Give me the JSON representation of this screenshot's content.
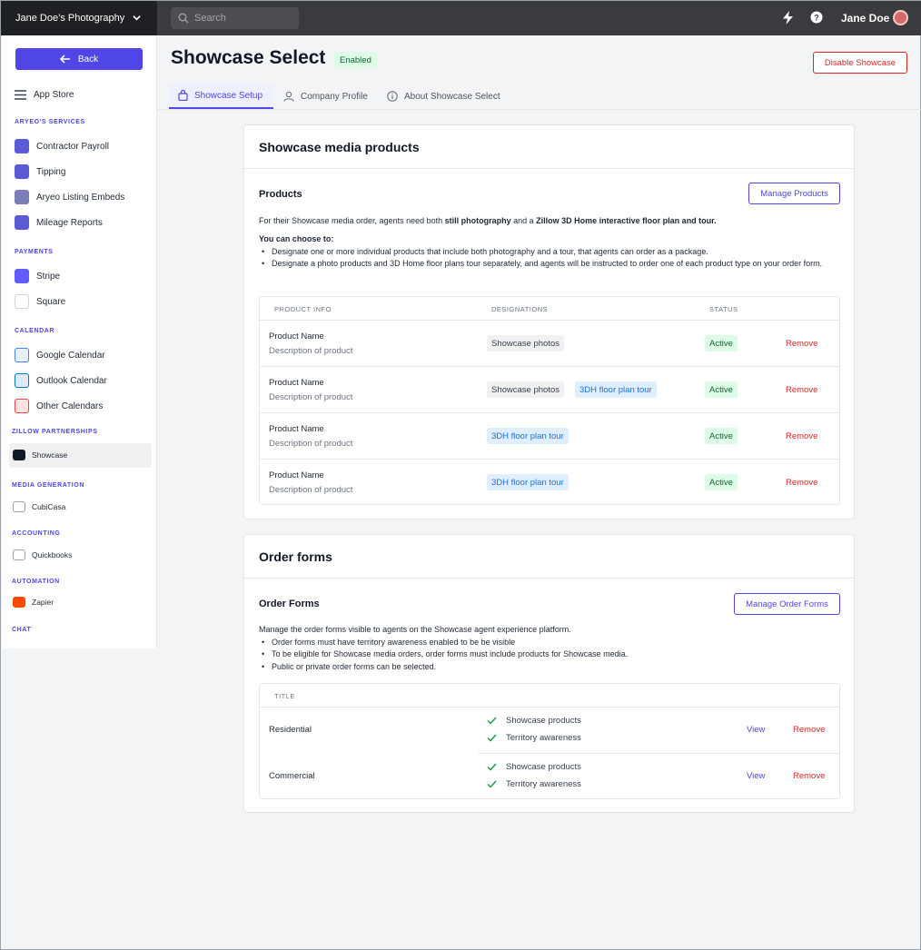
{
  "topbar": {
    "workspace": "Jane Doe’s Photography",
    "search_placeholder": "Search",
    "user_name": "Jane Doe"
  },
  "sidebar": {
    "back_label": "Back",
    "app_store_label": "App Store",
    "sections": {
      "services": "ARYEO'S SERVICES",
      "payments": "PAYMENTS",
      "calendar": "CALENDAR",
      "zillow": "ZILLOW PARTNERSHIPS",
      "media": "MEDIA GENERATION",
      "accounting": "ACCOUNTING",
      "automation": "AUTOMATION",
      "chat": "CHAT"
    },
    "items": {
      "contractor_payroll": "Contractor Payroll",
      "tipping": "Tipping",
      "listing_embeds": "Aryeo Listing Embeds",
      "mileage": "Mileage Reports",
      "stripe": "Stripe",
      "square": "Square",
      "google_calendar": "Google Calendar",
      "outlook_calendar": "Outlook Calendar",
      "other_calendars": "Other Calendars",
      "showcase": "Showcase",
      "cubicasa": "CubiCasa",
      "quickbooks": "Quickbooks",
      "zapier": "Zapier"
    }
  },
  "header": {
    "title": "Showcase Select",
    "status_badge": "Enabled",
    "disable_button": "Disable Showcase",
    "tabs": [
      "Showcase Setup",
      "Company Profile",
      "About Showcase Select"
    ]
  },
  "products_card": {
    "title": "Showcase media products",
    "subtitle": "Products",
    "manage_button": "Manage Products",
    "intro_prefix": "For their Showcase media order, agents need both ",
    "intro_bold1": "still photography",
    "intro_mid": " and a ",
    "intro_bold2": "Zillow 3D Home interactive floor plan and tour.",
    "choose_heading": "You can choose to:",
    "bullets": [
      "Designate one or more individual products that include both photography and a tour, that agents can order as a package.",
      "Designate a photo products and 3D Home floor plans tour separately, and agents will be instructed to order one of each product type on your order form."
    ],
    "columns": [
      "PRODUCT INFO",
      "DESIGNATIONS",
      "STATUS"
    ],
    "rows": [
      {
        "name": "Product Name",
        "desc": "Description of product",
        "tags": [
          "Showcase photos"
        ],
        "status": "Active",
        "action": "Remove"
      },
      {
        "name": "Product Name",
        "desc": "Description of product",
        "tags": [
          "Showcase photos",
          "3DH floor plan tour"
        ],
        "status": "Active",
        "action": "Remove"
      },
      {
        "name": "Product Name",
        "desc": "Description of product",
        "tags": [
          "3DH floor plan tour"
        ],
        "status": "Active",
        "action": "Remove"
      },
      {
        "name": "Product Name",
        "desc": "Description of product",
        "tags": [
          "3DH floor plan tour"
        ],
        "status": "Active",
        "action": "Remove"
      }
    ]
  },
  "orders_card": {
    "title": "Order forms",
    "subtitle": "Order Forms",
    "manage_button": "Manage Order Forms",
    "intro": "Manage the  order forms visible to agents on the Showcase agent experience platform.",
    "bullets": [
      "Order forms must have territory awareness enabled to be be visible",
      "To be eligible for Showcase media orders, order forms must include products for Showcase media.",
      "Public or private order forms can be selected."
    ],
    "column": "TITLE",
    "rows": [
      {
        "title": "Residential",
        "checks": [
          "Showcase products",
          "Territory awareness"
        ],
        "view": "View",
        "remove": "Remove"
      },
      {
        "title": "Commercial",
        "checks": [
          "Showcase products",
          "Territory awareness"
        ],
        "view": "View",
        "remove": "Remove"
      }
    ]
  }
}
